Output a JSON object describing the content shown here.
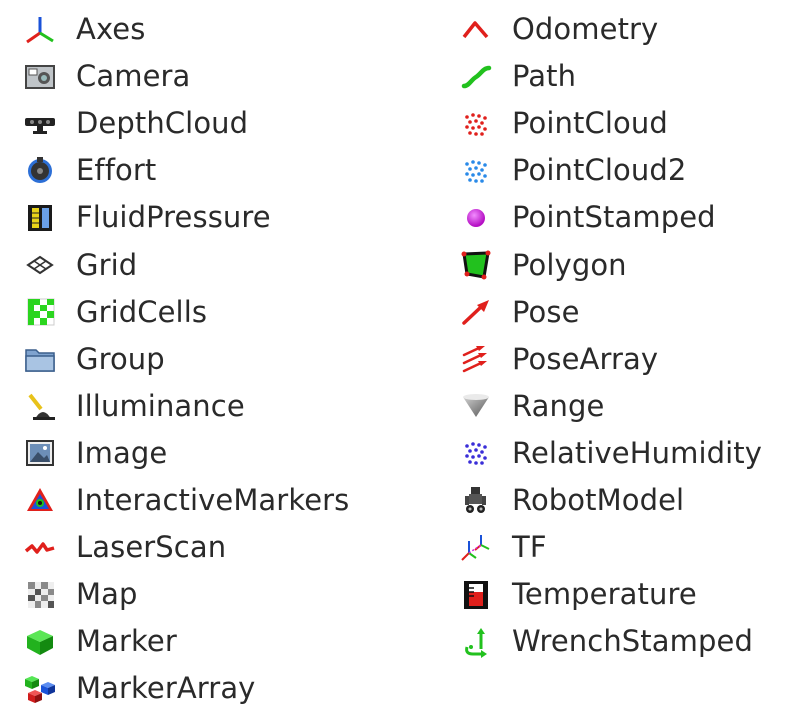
{
  "display_types": {
    "left_column": [
      {
        "label": "Axes",
        "icon": "axes-icon"
      },
      {
        "label": "Camera",
        "icon": "camera-icon"
      },
      {
        "label": "DepthCloud",
        "icon": "depth-camera-icon"
      },
      {
        "label": "Effort",
        "icon": "effort-icon"
      },
      {
        "label": "FluidPressure",
        "icon": "fluid-pressure-icon"
      },
      {
        "label": "Grid",
        "icon": "grid-icon"
      },
      {
        "label": "GridCells",
        "icon": "grid-cells-icon"
      },
      {
        "label": "Group",
        "icon": "folder-icon"
      },
      {
        "label": "Illuminance",
        "icon": "lamp-icon"
      },
      {
        "label": "Image",
        "icon": "image-icon"
      },
      {
        "label": "InteractiveMarkers",
        "icon": "interactive-markers-icon"
      },
      {
        "label": "LaserScan",
        "icon": "laser-scan-icon"
      },
      {
        "label": "Map",
        "icon": "map-icon"
      },
      {
        "label": "Marker",
        "icon": "cube-icon"
      },
      {
        "label": "MarkerArray",
        "icon": "cubes-icon"
      }
    ],
    "right_column": [
      {
        "label": "Odometry",
        "icon": "odometry-icon"
      },
      {
        "label": "Path",
        "icon": "path-icon"
      },
      {
        "label": "PointCloud",
        "icon": "point-cloud-icon"
      },
      {
        "label": "PointCloud2",
        "icon": "point-cloud2-icon"
      },
      {
        "label": "PointStamped",
        "icon": "point-stamped-icon"
      },
      {
        "label": "Polygon",
        "icon": "polygon-icon"
      },
      {
        "label": "Pose",
        "icon": "pose-arrow-icon"
      },
      {
        "label": "PoseArray",
        "icon": "pose-array-icon"
      },
      {
        "label": "Range",
        "icon": "range-cone-icon"
      },
      {
        "label": "RelativeHumidity",
        "icon": "humidity-icon"
      },
      {
        "label": "RobotModel",
        "icon": "robot-icon"
      },
      {
        "label": "TF",
        "icon": "tf-icon"
      },
      {
        "label": "Temperature",
        "icon": "thermometer-icon"
      },
      {
        "label": "WrenchStamped",
        "icon": "wrench-icon"
      }
    ]
  },
  "colors": {
    "text": "#2a2a2a",
    "red": "#e0201c",
    "green": "#22c11e",
    "blue": "#1a52d8",
    "magenta": "#d21ee0"
  }
}
